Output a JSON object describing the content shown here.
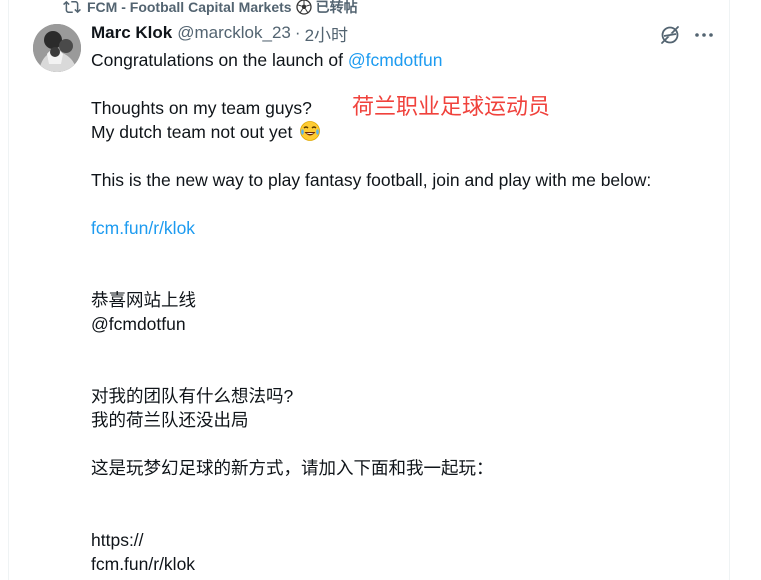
{
  "repost": {
    "icon": "repost-icon",
    "label_prefix": "FCM - Football Capital Markets",
    "emoji": "soccer-ball",
    "label_suffix": "已转帖"
  },
  "tweet": {
    "author_name": "Marc Klok",
    "handle": "@marcklok_23",
    "separator": "·",
    "time": "2小时",
    "lines": {
      "congrats_prefix": "Congratulations on the launch of ",
      "congrats_mention": "@fcmdotfun",
      "thoughts": "Thoughts on my team guys?",
      "dutch": "My dutch team not out yet",
      "dutch_emoji": "tears-of-joy",
      "new_way": "This is the new way to play fantasy football, join and play with me below:",
      "link": "fcm.fun/r/klok",
      "zh_congrats": "恭喜网站上线",
      "zh_mention": "@fcmdotfun",
      "zh_thoughts": "对我的团队有什么想法吗?",
      "zh_dutch": "我的荷兰队还没出局",
      "zh_new_way": "这是玩梦幻足球的新方式，请加入下面和我一起玩：",
      "zh_https": "https://",
      "zh_link": "fcm.fun/r/klok"
    }
  },
  "annotation": "荷兰职业足球运动员",
  "colors": {
    "text": "#0f1419",
    "secondary": "#536471",
    "link": "#1d9bf0",
    "annotation": "#f0423c"
  }
}
